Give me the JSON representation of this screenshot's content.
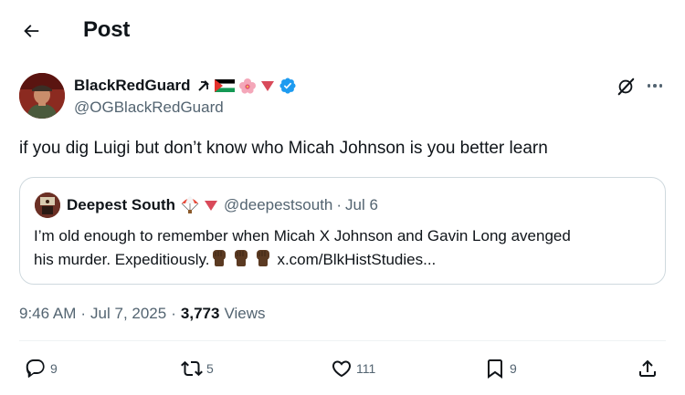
{
  "header": {
    "title": "Post"
  },
  "post": {
    "author_name": "BlackRedGuard",
    "handle": "@OGBlackRedGuard",
    "text": "if you dig Luigi but don’t know who Micah Johnson is you better learn",
    "timestamp": "9:46 AM",
    "date": "Jul 7, 2025",
    "views_count": "3,773",
    "views_label": "Views"
  },
  "quote": {
    "author_name": "Deepest South",
    "handle": "@deepestsouth",
    "date": "Jul 6",
    "text_line1": "I’m old enough to remember when Micah X Johnson and Gavin Long avenged",
    "text_line2": "his murder. Expeditiously.",
    "link": "x.com/BlkHistStudies..."
  },
  "actions": {
    "replies": "9",
    "reposts": "5",
    "likes": "111",
    "bookmarks": "9"
  },
  "colors": {
    "text": "#0f1419",
    "secondary": "#536471",
    "border": "#cfd9de",
    "verified": "#1d9bf0"
  },
  "icons": [
    "back-arrow-icon",
    "hammer-sickle-icon",
    "palestine-flag-icon",
    "hibiscus-icon",
    "red-triangle-icon",
    "verified-badge-icon",
    "grok-icon",
    "more-icon",
    "parachute-icon",
    "raised-fist-icon",
    "reply-icon",
    "repost-icon",
    "like-icon",
    "bookmark-icon",
    "share-icon"
  ]
}
